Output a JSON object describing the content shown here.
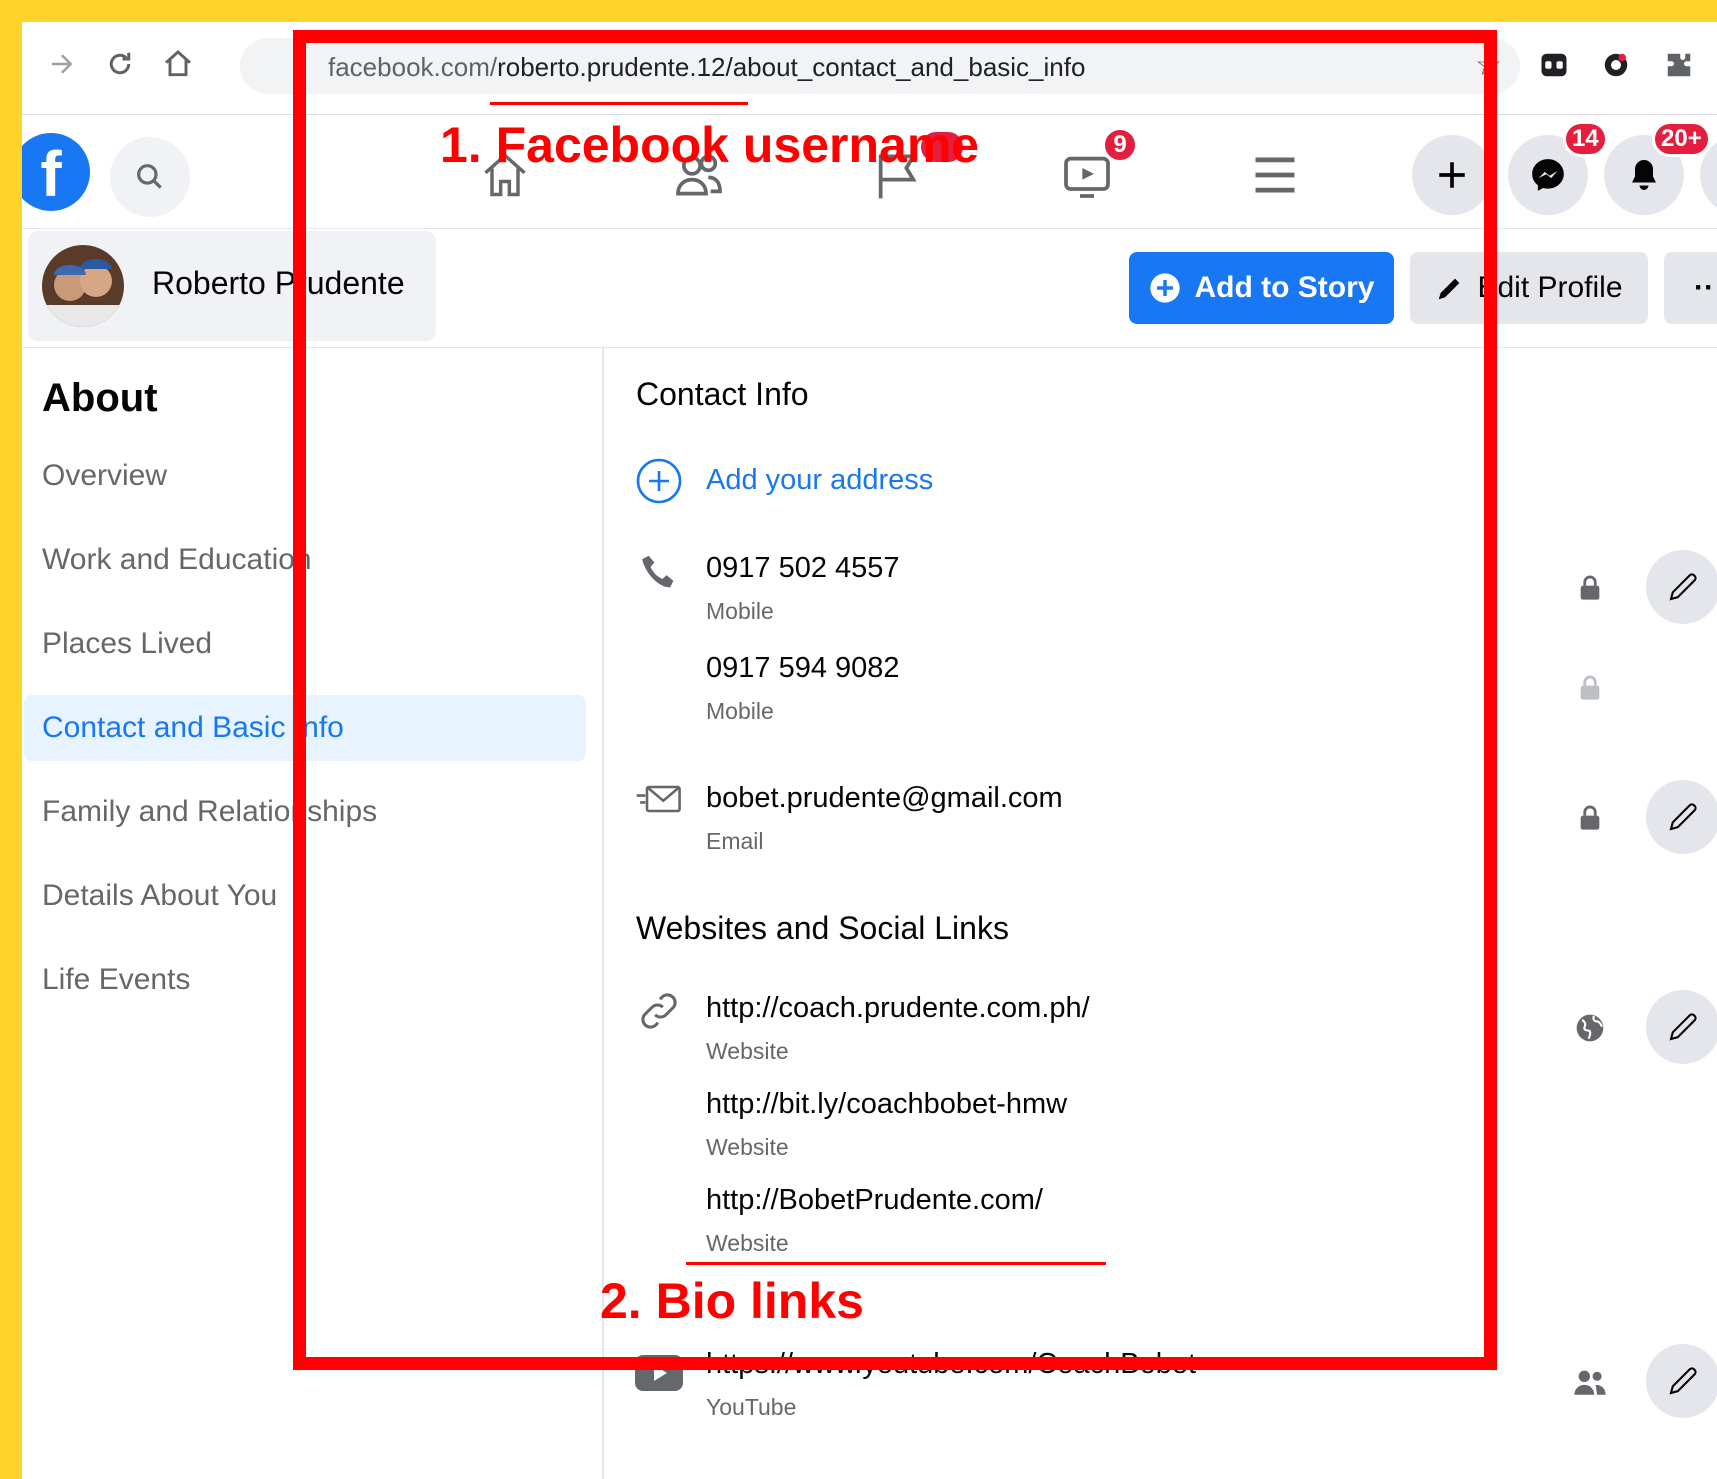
{
  "browser": {
    "url_host": "facebook.com/",
    "url_path": "roberto.prudente.12/about_contact_and_basic_info",
    "nav_icons": [
      "forward-icon",
      "reload-icon",
      "home-icon"
    ]
  },
  "fbnav": {
    "badges": {
      "watch": "9",
      "messenger": "14",
      "notifications": "20+"
    }
  },
  "profile": {
    "name": "Roberto Prudente",
    "add_to_story": "Add to Story",
    "edit_profile": "Edit Profile",
    "more": "··"
  },
  "sidebar": {
    "title": "About",
    "items": [
      {
        "label": "Overview"
      },
      {
        "label": "Work and Education"
      },
      {
        "label": "Places Lived"
      },
      {
        "label": "Contact and Basic Info",
        "active": true
      },
      {
        "label": "Family and Relationships"
      },
      {
        "label": "Details About You"
      },
      {
        "label": "Life Events"
      }
    ]
  },
  "contact": {
    "title": "Contact Info",
    "add_address": "Add your address",
    "phones": [
      {
        "number": "0917 502 4557",
        "type": "Mobile"
      },
      {
        "number": "0917 594 9082",
        "type": "Mobile"
      }
    ],
    "email": {
      "value": "bobet.prudente@gmail.com",
      "type": "Email"
    }
  },
  "websites": {
    "title": "Websites and Social Links",
    "links": [
      {
        "url": "http://coach.prudente.com.ph/",
        "type": "Website"
      },
      {
        "url": "http://bit.ly/coachbobet-hmw",
        "type": "Website"
      },
      {
        "url": "http://BobetPrudente.com/",
        "type": "Website"
      }
    ],
    "social": {
      "url": "https://www.youtube.com/CoachBobet",
      "type": "YouTube"
    }
  },
  "annotations": {
    "label1": "1. Facebook username",
    "label2": "2.  Bio links"
  },
  "colors": {
    "accent": "#1877f2",
    "annotation": "#ff0000",
    "background": "#FFD42A"
  }
}
